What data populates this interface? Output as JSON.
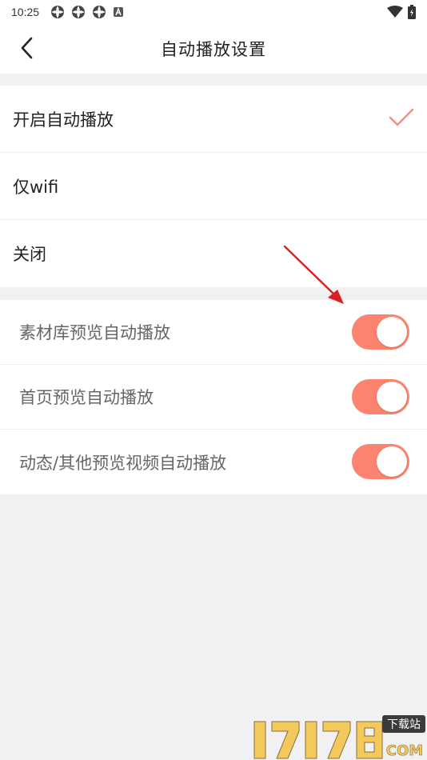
{
  "status_bar": {
    "time": "10:25",
    "left_icons": [
      "sync-icon",
      "sync-icon",
      "sync-icon",
      "keyboard-a-icon"
    ],
    "right_icons": [
      "wifi-icon",
      "battery-icon"
    ]
  },
  "header": {
    "title": "自动播放设置",
    "back_icon": "chevron-left-icon"
  },
  "autoplay_options": [
    {
      "label": "开启自动播放",
      "selected": true
    },
    {
      "label": "仅wifi",
      "selected": false
    },
    {
      "label": "关闭",
      "selected": false
    }
  ],
  "toggles": [
    {
      "label": "素材库预览自动播放",
      "on": true
    },
    {
      "label": "首页预览自动播放",
      "on": true
    },
    {
      "label": "动态/其他预览视频自动播放",
      "on": true
    }
  ],
  "watermark": {
    "logo_number": "17178",
    "logo_suffix": "COM",
    "logo_badge": "下载站"
  },
  "colors": {
    "accent": "#fb836f",
    "checkmark": "#f58f7f",
    "arrow": "#d91f1f",
    "page_background": "#f1f1f3"
  }
}
